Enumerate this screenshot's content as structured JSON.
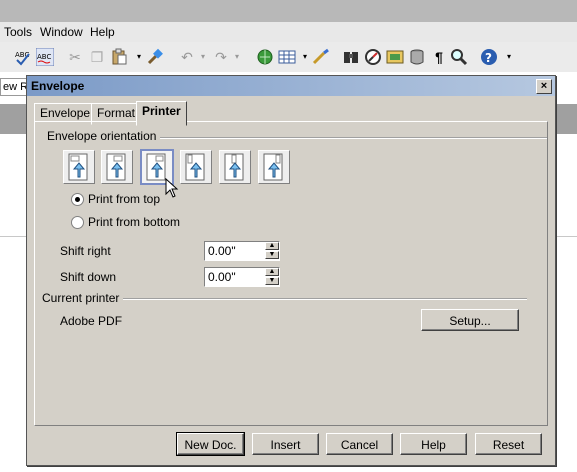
{
  "menubar": {
    "items": [
      "Tools",
      "Window",
      "Help"
    ]
  },
  "toolbar": {
    "icons": [
      "spellcheck-icon",
      "autospellcheck-icon",
      "cut-icon",
      "copy-icon",
      "paste-icon",
      "format-paintbrush-icon",
      "undo-icon",
      "redo-icon",
      "hyperlink-icon",
      "table-icon",
      "draw-icon",
      "find-icon",
      "navigator-icon",
      "gallery-icon",
      "datasource-icon",
      "formatting-marks-icon",
      "zoom-icon",
      "help-icon"
    ]
  },
  "background": {
    "left_field_text": "ew R"
  },
  "dialog": {
    "title": "Envelope",
    "close_label": "×",
    "tabs": [
      {
        "label": "Envelope",
        "active": false
      },
      {
        "label": "Format",
        "active": false
      },
      {
        "label": "Printer",
        "active": true
      }
    ],
    "orientation": {
      "group_label": "Envelope orientation",
      "buttons": [
        "orientation-1",
        "orientation-2",
        "orientation-3",
        "orientation-4",
        "orientation-5",
        "orientation-6"
      ],
      "selected_index": 2
    },
    "print_from": {
      "options": [
        {
          "label": "Print from top",
          "checked": true
        },
        {
          "label": "Print from bottom",
          "checked": false
        }
      ]
    },
    "shift_right": {
      "label": "Shift right",
      "value": "0.00\""
    },
    "shift_down": {
      "label": "Shift down",
      "value": "0.00\""
    },
    "current_printer": {
      "group_label": "Current printer",
      "name": "Adobe PDF",
      "setup_label": "Setup..."
    },
    "buttons": {
      "new_doc": "New Doc.",
      "insert": "Insert",
      "cancel": "Cancel",
      "help": "Help",
      "reset": "Reset"
    }
  }
}
